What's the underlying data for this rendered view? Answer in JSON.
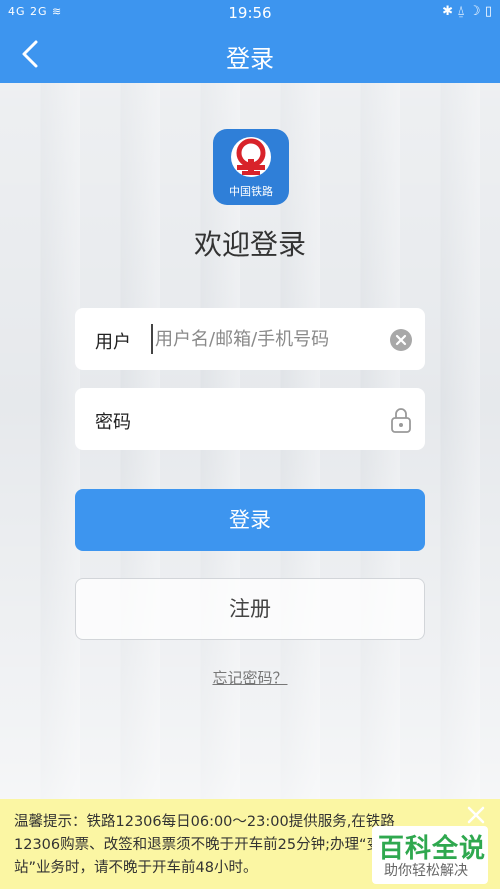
{
  "status_bar": {
    "left": "4G 2G ≋",
    "time": "19:56",
    "right": "✱ ⍙ ☽ ▯"
  },
  "nav": {
    "title": "登录",
    "back_icon": "chevron-left-icon"
  },
  "logo": {
    "text": "中国铁路"
  },
  "welcome": "欢迎登录",
  "username": {
    "label": "用户",
    "placeholder": "用户名/邮箱/手机号码",
    "value": ""
  },
  "password": {
    "label": "密码",
    "value": ""
  },
  "buttons": {
    "login": "登录",
    "register": "注册",
    "forgot": "忘记密码？"
  },
  "notice": {
    "text": "温馨提示：铁路12306每日06:00～23:00提供服务,在铁路12306购票、改签和退票须不晚于开车前25分钟;办理“变更到站”业务时，请不晚于开车前48小时。"
  },
  "watermark": {
    "main": "百科全说",
    "sub": "助你轻松解决"
  },
  "colors": {
    "primary": "#3d95ef",
    "notice_bg": "#fbf6a3",
    "watermark_green": "#2fa84f"
  }
}
